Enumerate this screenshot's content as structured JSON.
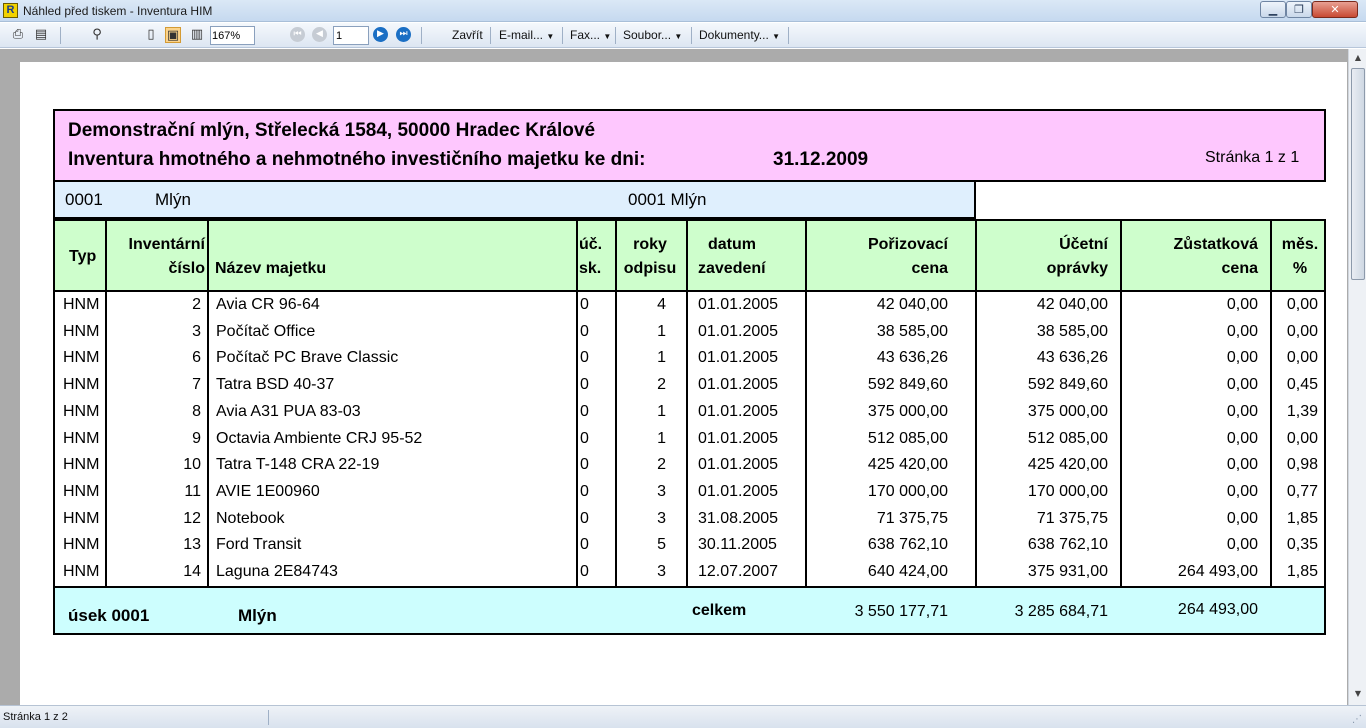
{
  "window": {
    "title": "Náhled před tiskem - Inventura HIM",
    "app_icon_letter": "R"
  },
  "toolbar": {
    "zoom_value": "167%",
    "page_value": "1",
    "menus": {
      "close": "Zavřít",
      "email": "E-mail...",
      "fax": "Fax...",
      "file": "Soubor...",
      "documents": "Dokumenty..."
    }
  },
  "report": {
    "company_line": "Demonstrační mlýn, Střelecká  1584, 50000 Hradec Králové",
    "title": "Inventura hmotného a nehmotného investičního majetku ke dni:",
    "date": "31.12.2009",
    "page_info": "Stránka 1 z 1",
    "section": {
      "code": "0001",
      "name": "Mlýn",
      "full": "0001 Mlýn"
    },
    "columns": {
      "typ": "Typ",
      "inv_a": "Inventární",
      "inv_b": "číslo",
      "nazev": "Název majetku",
      "uc_a": "úč.",
      "uc_b": "sk.",
      "roky_a": "roky",
      "roky_b": "odpisu",
      "datum_a": "datum",
      "datum_b": "zavedení",
      "poriz_a": "Pořizovací",
      "poriz_b": "cena",
      "ucet_a": "Účetní",
      "ucet_b": "oprávky",
      "zust_a": "Zůstatková",
      "zust_b": "cena",
      "mes_a": "měs.",
      "mes_b": "%"
    },
    "rows": [
      {
        "typ": "HNM",
        "cislo": "2",
        "nazev": "Avia CR 96-64",
        "uc": "0",
        "roky": "4",
        "datum": "01.01.2005",
        "poriz": "42 040,00",
        "ucet": "42 040,00",
        "zust": "0,00",
        "mes": "0,00"
      },
      {
        "typ": "HNM",
        "cislo": "3",
        "nazev": "Počítač Office",
        "uc": "0",
        "roky": "1",
        "datum": "01.01.2005",
        "poriz": "38 585,00",
        "ucet": "38 585,00",
        "zust": "0,00",
        "mes": "0,00"
      },
      {
        "typ": "HNM",
        "cislo": "6",
        "nazev": "Počítač PC Brave Classic",
        "uc": "0",
        "roky": "1",
        "datum": "01.01.2005",
        "poriz": "43 636,26",
        "ucet": "43 636,26",
        "zust": "0,00",
        "mes": "0,00"
      },
      {
        "typ": "HNM",
        "cislo": "7",
        "nazev": "Tatra BSD 40-37",
        "uc": "0",
        "roky": "2",
        "datum": "01.01.2005",
        "poriz": "592 849,60",
        "ucet": "592 849,60",
        "zust": "0,00",
        "mes": "0,45"
      },
      {
        "typ": "HNM",
        "cislo": "8",
        "nazev": "Avia A31 PUA 83-03",
        "uc": "0",
        "roky": "1",
        "datum": "01.01.2005",
        "poriz": "375 000,00",
        "ucet": "375 000,00",
        "zust": "0,00",
        "mes": "1,39"
      },
      {
        "typ": "HNM",
        "cislo": "9",
        "nazev": "Octavia Ambiente CRJ 95-52",
        "uc": "0",
        "roky": "1",
        "datum": "01.01.2005",
        "poriz": "512 085,00",
        "ucet": "512 085,00",
        "zust": "0,00",
        "mes": "0,00"
      },
      {
        "typ": "HNM",
        "cislo": "10",
        "nazev": "Tatra T-148 CRA 22-19",
        "uc": "0",
        "roky": "2",
        "datum": "01.01.2005",
        "poriz": "425 420,00",
        "ucet": "425 420,00",
        "zust": "0,00",
        "mes": "0,98"
      },
      {
        "typ": "HNM",
        "cislo": "11",
        "nazev": "AVIE 1E00960",
        "uc": "0",
        "roky": "3",
        "datum": "01.01.2005",
        "poriz": "170 000,00",
        "ucet": "170 000,00",
        "zust": "0,00",
        "mes": "0,77"
      },
      {
        "typ": "HNM",
        "cislo": "12",
        "nazev": "Notebook",
        "uc": "0",
        "roky": "3",
        "datum": "31.08.2005",
        "poriz": "71 375,75",
        "ucet": "71 375,75",
        "zust": "0,00",
        "mes": "1,85"
      },
      {
        "typ": "HNM",
        "cislo": "13",
        "nazev": "Ford Transit",
        "uc": "0",
        "roky": "5",
        "datum": "30.11.2005",
        "poriz": "638 762,10",
        "ucet": "638 762,10",
        "zust": "0,00",
        "mes": "0,35"
      },
      {
        "typ": "HNM",
        "cislo": "14",
        "nazev": "Laguna 2E84743",
        "uc": "0",
        "roky": "3",
        "datum": "12.07.2007",
        "poriz": "640 424,00",
        "ucet": "375 931,00",
        "zust": "264 493,00",
        "mes": "1,85"
      }
    ],
    "total": {
      "label": "úsek 0001",
      "name": "Mlýn",
      "celkem": "celkem",
      "poriz": "3 550 177,71",
      "ucet": "3 285 684,71",
      "zust": "264 493,00"
    }
  },
  "status": {
    "text": "Stránka 1 z 2"
  },
  "colors": {
    "header_bg": "#fec7fe",
    "section_bg": "#dfeffd",
    "colhead_bg": "#cefecc",
    "total_bg": "#cdfefe",
    "workspace_bg": "#ababab"
  }
}
